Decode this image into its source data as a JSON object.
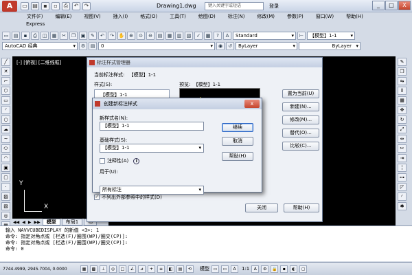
{
  "app": {
    "logo": "A",
    "doc_title": "Drawing1.dwg",
    "search_placeholder": "键入关键字或短语",
    "login": "登录",
    "win_min": "_",
    "win_max": "□",
    "win_close": "X"
  },
  "menu": [
    "文件(F)",
    "编辑(E)",
    "视图(V)",
    "插入(I)",
    "格式(O)",
    "工具(T)",
    "绘图(D)",
    "标注(N)",
    "修改(M)",
    "参数(P)",
    "窗口(W)",
    "帮助(H)"
  ],
  "express": "Express",
  "toolbar": {
    "style_combo": "Standard",
    "annotation_combo": "【模型】1-1",
    "workspace_combo": "AutoCAD 经典",
    "layer_value": "0",
    "color_combo": "ByLayer",
    "linetype_value": "ByLayer"
  },
  "viewport_label": "[-] [俯视] [二维线框]",
  "ucs": {
    "y": "Y",
    "x": "X"
  },
  "layout_tabs": {
    "nav": [
      "◀◀",
      "◀",
      "▶",
      "▶▶"
    ],
    "tabs": [
      "模型",
      "布局1",
      "布"
    ]
  },
  "command_lines": [
    "输入 NAVVCUBEDISPLAY 的新值 <3>: 1",
    "命令: 指定对角点或 [栏选(F)/圈围(WP)/圈交(CP)]:",
    "命令: 指定对角点或 [栏选(F)/圈围(WP)/圈交(CP)]:",
    "命令: 0"
  ],
  "status": {
    "coords": "7744.4999, 2945.7004, 0.0000",
    "model": "模型",
    "scale": "1:1"
  },
  "dim_manager": {
    "title": "标注样式管理器",
    "current_style_label": "当前标注样式:",
    "current_style_value": "【模型】1-1",
    "styles_label": "样式(S):",
    "style_item": "【模型】1-1",
    "preview_label": "预览:",
    "preview_value": "【模型】1-1",
    "set_current": "置为当前(U)",
    "new": "新建(N)...",
    "modify": "修改(M)...",
    "override": "替代(O)...",
    "compare": "比较(C)...",
    "exclude_xref": "不列出外部参照中的样式(D)",
    "close": "关闭",
    "help": "帮助(H)"
  },
  "new_style_dialog": {
    "title": "创建新标注样式",
    "close_glyph": "x",
    "name_label": "新样式名(N):",
    "name_value": "【模型】1-1",
    "base_label": "基础样式(S):",
    "base_value": "【模型】1-1",
    "annotative_label": "注释性(A)",
    "info": "i",
    "use_for_label": "用于(U):",
    "use_for_value": "所有标注",
    "continue": "继续",
    "cancel": "取消",
    "help": "帮助(H)"
  }
}
